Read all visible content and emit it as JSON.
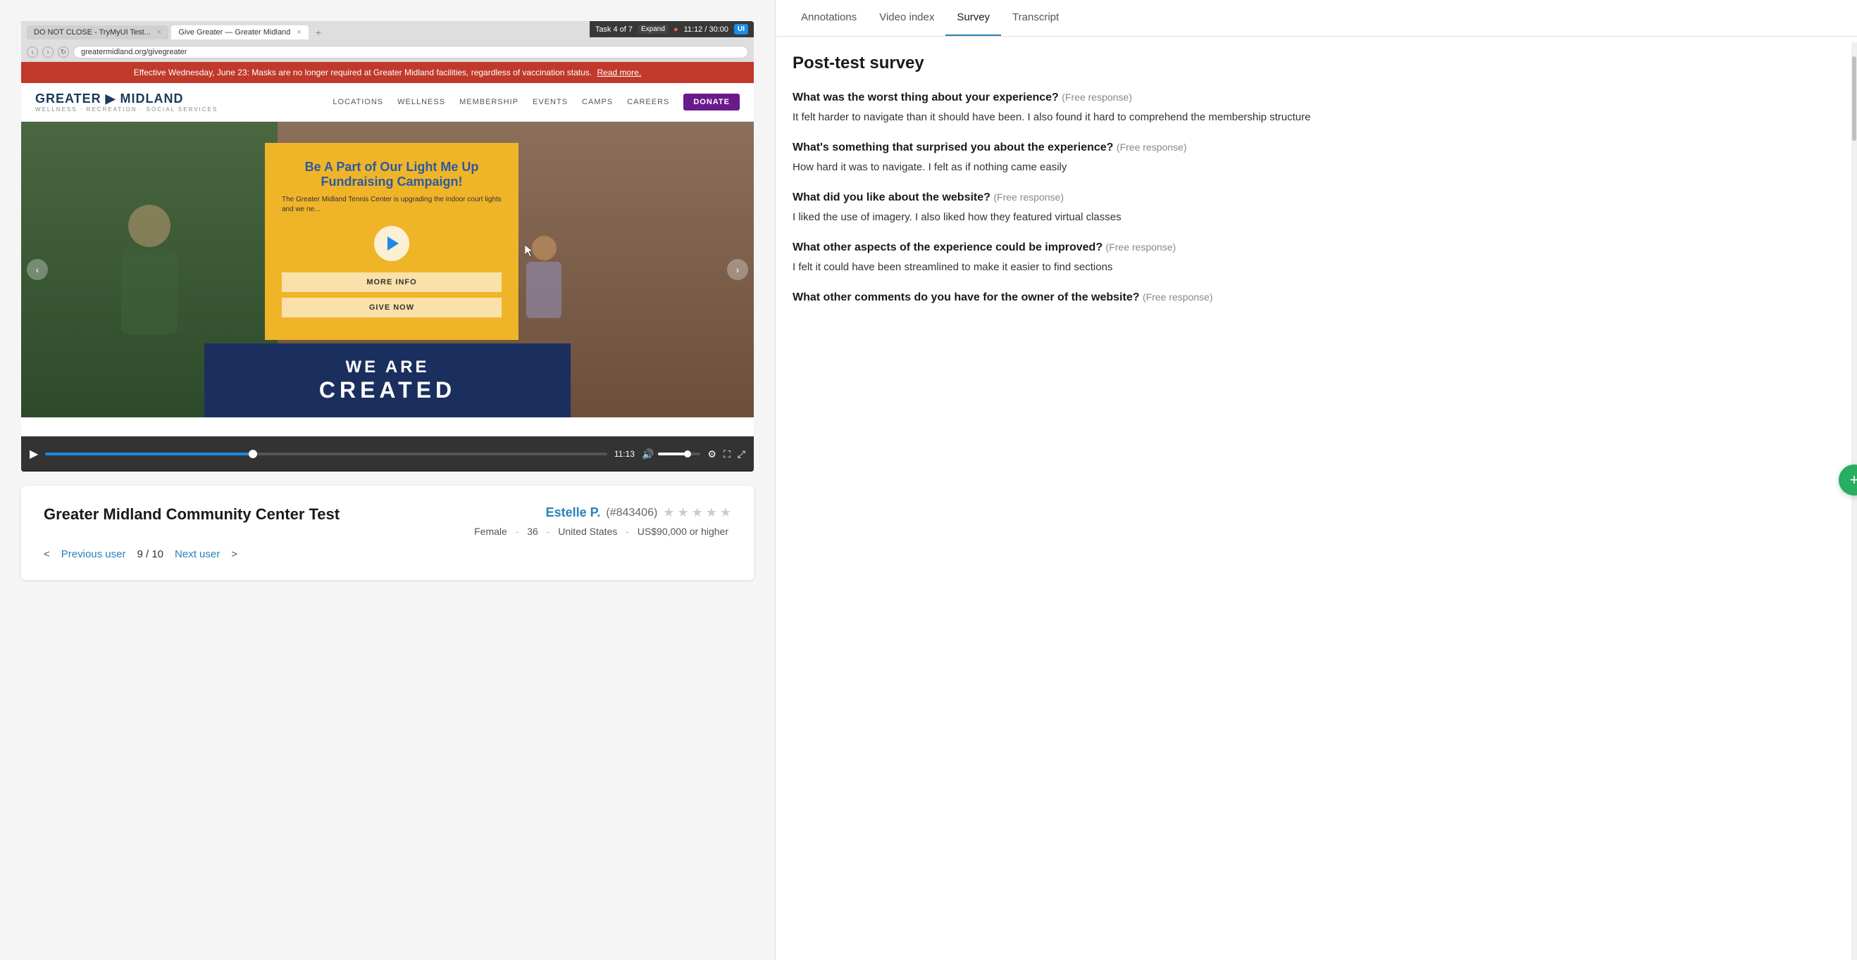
{
  "browser": {
    "tabs": [
      {
        "label": "DO NOT CLOSE - TryMyUI Test...",
        "active": false
      },
      {
        "label": "Give Greater — Greater Midland",
        "active": true
      }
    ],
    "address": "greatermidland.org/givegreater"
  },
  "task_bar": {
    "task_label": "Task 4 of 7",
    "expand_label": "Expand",
    "time": "11:12 / 30:00",
    "ui_label": "UI"
  },
  "website": {
    "alert": {
      "text": "Effective Wednesday, June 23: Masks are no longer required at Greater Midland facilities, regardless of vaccination status.",
      "link_text": "Read more."
    },
    "nav": {
      "logo_main": "GREATER ▶ MIDLAND",
      "logo_sub": "WELLNESS · RECREATION · SOCIAL SERVICES",
      "links": [
        "LOCATIONS",
        "WELLNESS",
        "MEMBERSHIP",
        "EVENTS",
        "CAMPS",
        "CAREERS"
      ],
      "donate_label": "DONATE"
    },
    "hero": {
      "popup_title": "Be A Part of Our Light Me Up Fundraising Campaign!",
      "popup_text": "The Greater Midland Tennis Center is upgrading the indoor court lights and we ne...",
      "more_info_label": "MORE INFO",
      "give_now_label": "GIVE NOW",
      "banner_line1": "WE ARE",
      "banner_line2": "CREATED"
    }
  },
  "video_controls": {
    "time_current": "11:13",
    "progress_percent": 37
  },
  "info_card": {
    "test_title": "Greater Midland Community Center Test",
    "user_name": "Estelle P.",
    "user_id": "(#843406)",
    "page_current": "9",
    "page_total": "10",
    "prev_label": "Previous user",
    "next_label": "Next user",
    "demographics": {
      "gender": "Female",
      "age": "36",
      "country": "United States",
      "income": "US$90,000 or higher"
    }
  },
  "right_panel": {
    "tabs": [
      "Annotations",
      "Video index",
      "Survey",
      "Transcript"
    ],
    "active_tab": "Survey",
    "survey": {
      "title": "Post-test survey",
      "questions": [
        {
          "question": "What was the worst thing about your experience?",
          "type": "Free response",
          "answer": "It felt harder to navigate than it should have been. I also found it hard to comprehend the membership structure"
        },
        {
          "question": "What's something that surprised you about the experience?",
          "type": "Free response",
          "answer": "How hard it was to navigate. I felt as if nothing came easily"
        },
        {
          "question": "What did you like about the website?",
          "type": "Free response",
          "answer": "I liked the use of imagery. I also liked how they featured virtual classes"
        },
        {
          "question": "What other aspects of the experience could be improved?",
          "type": "Free response",
          "answer": "I felt it could have been streamlined to make it easier to find sections"
        },
        {
          "question": "What other comments do you have for the owner of the website?",
          "type": "Free response",
          "answer": ""
        }
      ]
    }
  }
}
